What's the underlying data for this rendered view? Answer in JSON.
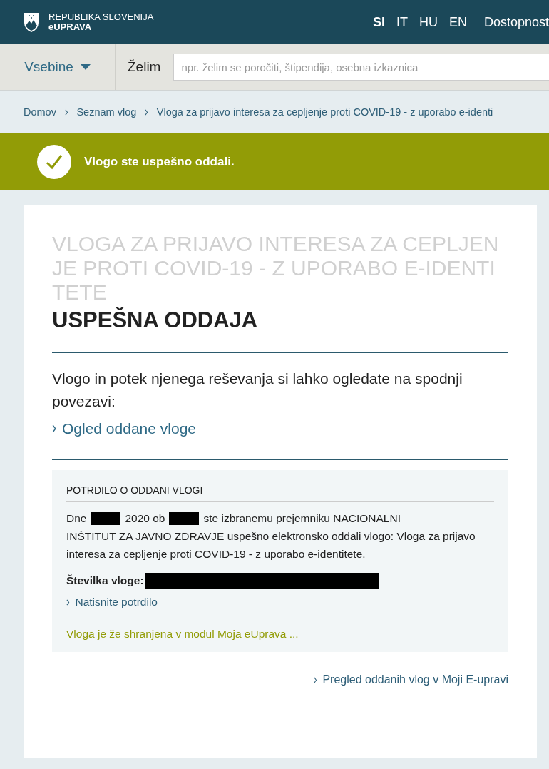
{
  "header": {
    "brand_top": "REPUBLIKA SLOVENIJA",
    "brand_bottom": "eUPRAVA",
    "languages": [
      {
        "label": "SI",
        "selected": true
      },
      {
        "label": "IT",
        "selected": false
      },
      {
        "label": "HU",
        "selected": false
      },
      {
        "label": "EN",
        "selected": false
      }
    ],
    "accessibility": "Dostopnost"
  },
  "toolbar": {
    "menu": "Vsebine",
    "search_label": "Želim",
    "search": {
      "placeholder": "npr. želim se poročiti, štipendija, osebna izkaznica"
    }
  },
  "breadcrumbs": [
    "Domov",
    "Seznam vlog",
    "Vloga za prijavo interesa za cepljenje proti COVID-19 - z uporabo e-identi"
  ],
  "alert": {
    "message": "Vlogo ste uspešno oddali."
  },
  "card": {
    "form_title": "VLOGA ZA PRIJAVO INTERESA ZA CEPLJENJE PROTI COVID-19 - Z UPORABO E-IDENTITETE",
    "heading": "USPEŠNA ODDAJA",
    "intro": "Vlogo in potek njenega reševanja si lahko ogledate na spodnji povezavi:",
    "view_link": "Ogled oddane vloge",
    "receipt": {
      "title": "POTRDILO O ODDANI VLOGI",
      "parts": [
        {
          "kind": "text",
          "text": "Dne"
        },
        {
          "kind": "redacted"
        },
        {
          "kind": "text",
          "text": "2020 ob"
        },
        {
          "kind": "redacted"
        },
        {
          "kind": "text",
          "text": "ste izbranemu prejemniku NACIONALNI"
        },
        {
          "kind": "paragraph",
          "text": "INŠTITUT ZA JAVNO ZDRAVJE uspešno elektronsko oddali vlogo: Vloga za prijavo interesa za cepljenje proti COVID-19 - z uporabo e-identitete."
        }
      ],
      "number_label": "Številka vloge:",
      "print_link": "Natisnite potrdilo",
      "saved_note": "Vloga je že shranjena v modul Moja eUprava ..."
    },
    "overview_link": "Pregled oddanih vlog v Moji E-upravi"
  }
}
